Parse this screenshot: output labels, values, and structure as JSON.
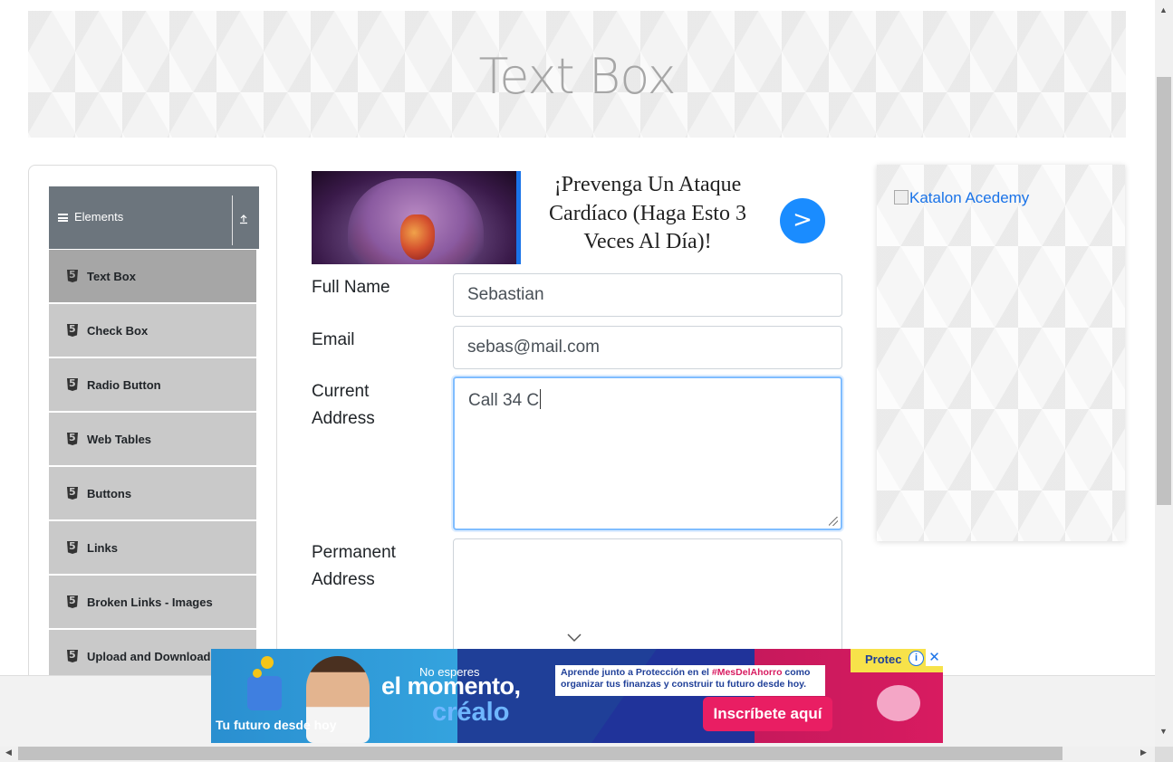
{
  "page": {
    "title": "Text Box"
  },
  "sidebar": {
    "group_label": "Elements",
    "items": [
      {
        "label": "Text Box",
        "active": true
      },
      {
        "label": "Check Box"
      },
      {
        "label": "Radio Button"
      },
      {
        "label": "Web Tables"
      },
      {
        "label": "Buttons"
      },
      {
        "label": "Links"
      },
      {
        "label": "Broken Links - Images"
      },
      {
        "label": "Upload and Download"
      }
    ]
  },
  "ad_top": {
    "headline": "¡Prevenga Un Ataque Cardíaco (Haga Esto 3 Veces Al Día)!",
    "button": ">"
  },
  "form": {
    "full_name": {
      "label": "Full Name",
      "value": "Sebastian"
    },
    "email": {
      "label": "Email",
      "value": "sebas@mail.com"
    },
    "current_address": {
      "label": "Current Address",
      "value": "Call 34 C"
    },
    "permanent_address": {
      "label": "Permanent Address",
      "value": ""
    }
  },
  "right_ad": {
    "alt_text": "Katalon Acedemy"
  },
  "ad_bottom": {
    "tagline": "Tu futuro desde hoy",
    "small": "No esperes",
    "big": "el momento,",
    "big2": "créalo",
    "info_pre": "Aprende junto a Protección en el ",
    "info_hashtag": "#MesDelAhorro",
    "info_post": " como organizar tus finanzas y construir tu futuro desde hoy.",
    "cta": "Inscríbete aquí",
    "brand": "Protec",
    "close": "✕",
    "adchoices": "i"
  },
  "colors": {
    "accent": "#1a8cff",
    "sidebar_header": "#6c757d",
    "active_item": "#a6a6a6",
    "menu_item": "#c9c9c9",
    "focus_border": "#80bdff"
  }
}
